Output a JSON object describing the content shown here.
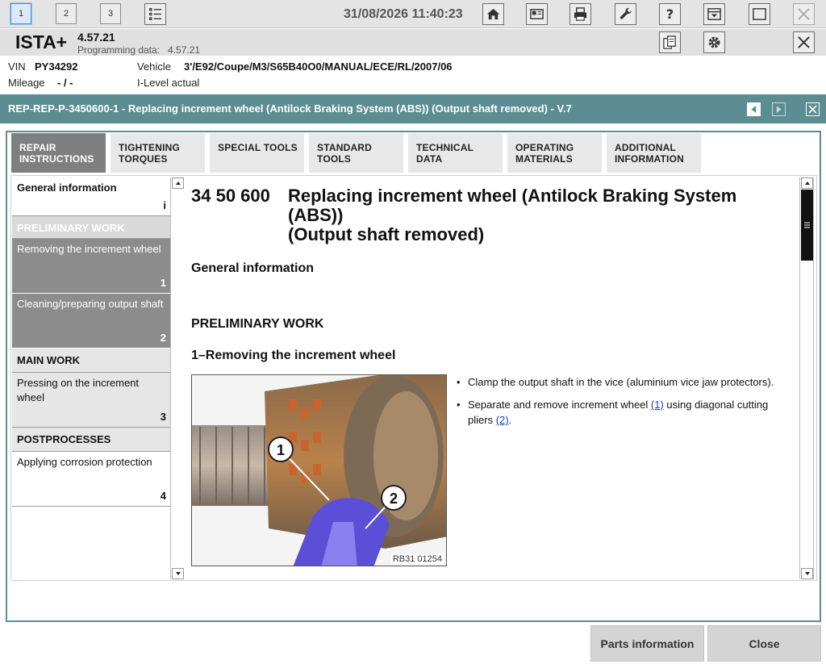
{
  "toolbar": {
    "pages": [
      "1",
      "2",
      "3"
    ],
    "datetime": "31/08/2026 11:40:23"
  },
  "app": {
    "name": "ISTA+",
    "version": "4.57.21",
    "programming_label": "Programming data:",
    "programming_value": "4.57.21"
  },
  "vehicle": {
    "vin_label": "VIN",
    "vin": "PY34292",
    "mileage_label": "Mileage",
    "mileage": "- / -",
    "vehicle_label": "Vehicle",
    "vehicle": "3'/E92/Coupe/M3/S65B40O0/MANUAL/ECE/RL/2007/06",
    "ilevel": "I-Level actual"
  },
  "document": {
    "title": "REP-REP-P-3450600-1 - Replacing increment wheel (Antilock Braking System (ABS))  (Output shaft removed) - V.7"
  },
  "tabs": [
    {
      "l1": "REPAIR",
      "l2": "INSTRUCTIONS"
    },
    {
      "l1": "TIGHTENING",
      "l2": "TORQUES"
    },
    {
      "l1": "SPECIAL TOOLS",
      "l2": ""
    },
    {
      "l1": "STANDARD",
      "l2": "TOOLS"
    },
    {
      "l1": "TECHNICAL",
      "l2": "DATA"
    },
    {
      "l1": "OPERATING",
      "l2": "MATERIALS"
    },
    {
      "l1": "ADDITIONAL",
      "l2": "INFORMATION"
    }
  ],
  "nav": {
    "general": "General information",
    "general_num": "i",
    "prelim": "PRELIMINARY WORK",
    "item1": "Removing the increment wheel",
    "item1_num": "1",
    "item2": "Cleaning/preparing output shaft",
    "item2_num": "2",
    "main": "MAIN WORK",
    "item3": "Pressing on the increment wheel",
    "item3_num": "3",
    "post": "POSTPROCESSES",
    "item4": "Applying corrosion protection",
    "item4_num": "4"
  },
  "content": {
    "code": "34 50 600",
    "title_l1": "Replacing increment wheel (Antilock Braking System",
    "title_l2": "(ABS))",
    "title_l3": "(Output shaft removed)",
    "general": "General information",
    "prelim": "PRELIMINARY WORK",
    "step1": "1–Removing the increment wheel",
    "figure_caption": "RB31 01254",
    "callout1": "1",
    "callout2": "2",
    "bullet1": "Clamp the output shaft in the vice (aluminium vice jaw protectors).",
    "bullet2_a": "Separate and remove increment wheel ",
    "bullet2_link1": "(1)",
    "bullet2_b": " using diagonal cutting pliers ",
    "bullet2_link2": "(2)",
    "bullet2_c": "."
  },
  "buttons": {
    "parts": "Parts information",
    "close": "Close"
  },
  "colors": {
    "teal": "#5b8d93",
    "tab_active": "#7f7f7f",
    "nav_grey": "#8c8c8c",
    "link": "#1a3fb5"
  }
}
